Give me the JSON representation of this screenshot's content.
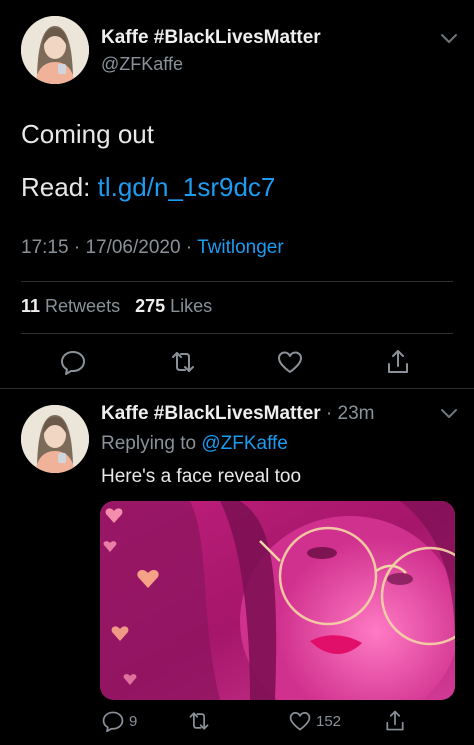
{
  "tweet": {
    "author_name": "Kaffe #BlackLivesMatter",
    "author_handle": "@ZFKaffe",
    "text": "Coming out",
    "read_label": "Read: ",
    "read_link": "tl.gd/n_1sr9dc7",
    "time": "17:15",
    "sep1": " · ",
    "date": "17/06/2020",
    "sep2": " · ",
    "source": "Twitlonger",
    "retweets_count": "11",
    "retweets_label": " Retweets",
    "likes_count": "275",
    "likes_label": " Likes"
  },
  "reply": {
    "author_name": "Kaffe #BlackLivesMatter",
    "dot": " · ",
    "time_ago": "23m",
    "replying_to_label": "Replying to ",
    "replying_to_handle": "@ZFKaffe",
    "text": "Here's a face reveal too",
    "reply_count": "9",
    "like_count": "152"
  },
  "colors": {
    "background": "#000000",
    "link": "#1d9bf0",
    "muted": "#8a9199",
    "photo_pink": "#d42a8c"
  },
  "icons": [
    "chevron-down-icon",
    "reply-icon",
    "retweet-icon",
    "like-icon",
    "share-icon"
  ]
}
